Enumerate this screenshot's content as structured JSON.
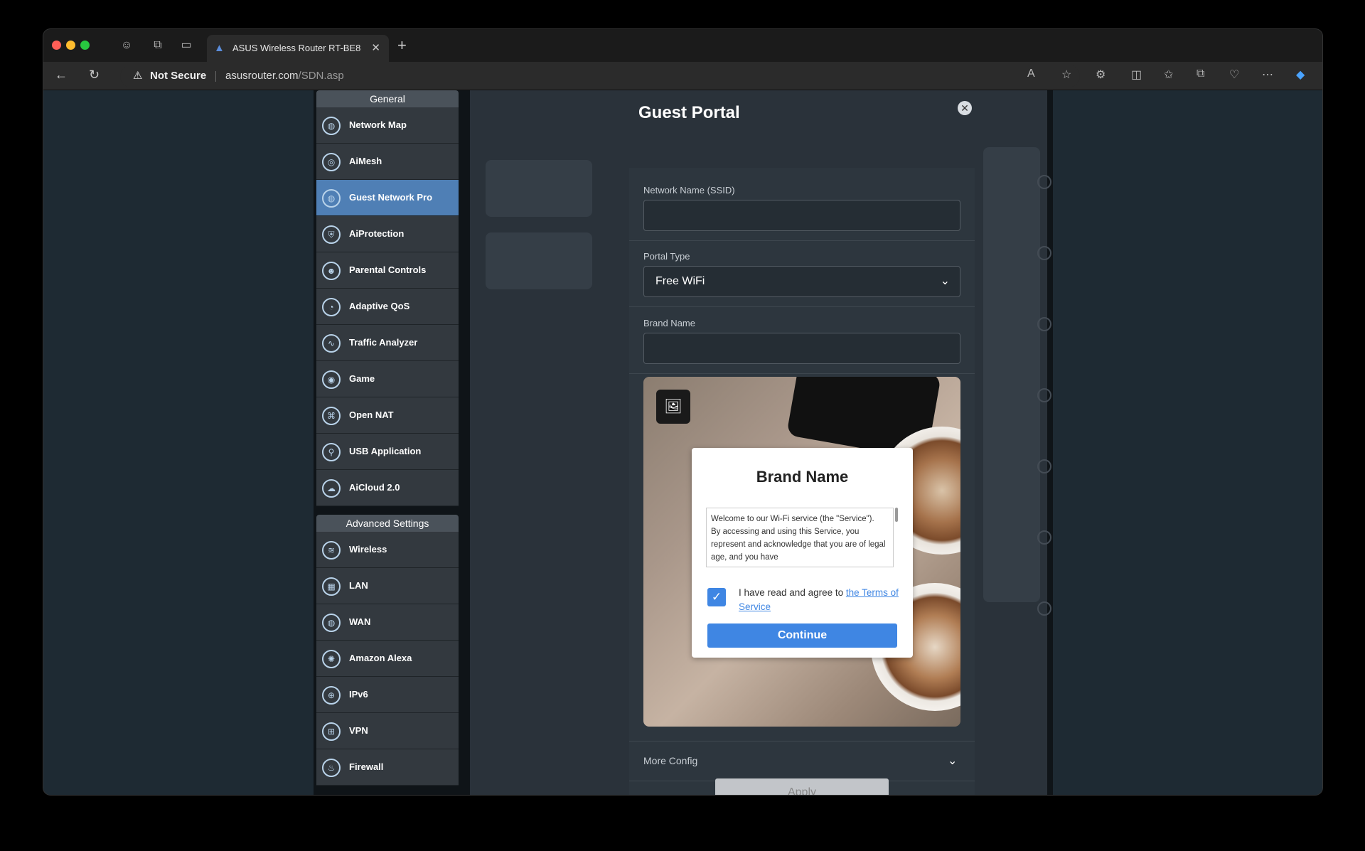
{
  "browser": {
    "tab_title": "ASUS Wireless Router RT-BE8",
    "security_label": "Not Secure",
    "url_host": "asusrouter.com",
    "url_path": "/SDN.asp"
  },
  "sidebar": {
    "general_title": "General",
    "general_items": [
      {
        "label": "Network Map",
        "icon": "globe-icon"
      },
      {
        "label": "AiMesh",
        "icon": "mesh-icon"
      },
      {
        "label": "Guest Network Pro",
        "icon": "globe-icon",
        "active": true
      },
      {
        "label": "AiProtection",
        "icon": "shield-icon"
      },
      {
        "label": "Parental Controls",
        "icon": "family-icon"
      },
      {
        "label": "Adaptive QoS",
        "icon": "gauge-icon"
      },
      {
        "label": "Traffic Analyzer",
        "icon": "chart-icon"
      },
      {
        "label": "Game",
        "icon": "gamepad-icon"
      },
      {
        "label": "Open NAT",
        "icon": "network-icon"
      },
      {
        "label": "USB Application",
        "icon": "usb-icon"
      },
      {
        "label": "AiCloud 2.0",
        "icon": "cloud-icon"
      }
    ],
    "advanced_title": "Advanced Settings",
    "advanced_items": [
      {
        "label": "Wireless",
        "icon": "wifi-icon"
      },
      {
        "label": "LAN",
        "icon": "lan-icon"
      },
      {
        "label": "WAN",
        "icon": "globe-icon"
      },
      {
        "label": "Amazon Alexa",
        "icon": "alexa-icon"
      },
      {
        "label": "IPv6",
        "icon": "ipv6-icon"
      },
      {
        "label": "VPN",
        "icon": "vpn-icon"
      },
      {
        "label": "Firewall",
        "icon": "fire-icon"
      }
    ]
  },
  "modal": {
    "title": "Guest Portal",
    "ssid_label": "Network Name (SSID)",
    "ssid_value": "",
    "portal_type_label": "Portal Type",
    "portal_type_value": "Free WiFi",
    "brand_name_label": "Brand Name",
    "brand_name_value": "",
    "preview": {
      "brand_title": "Brand Name",
      "terms_text": "Welcome to our Wi-Fi service (the \"Service\"). By accessing and using this Service, you represent and acknowledge that you are of legal age, and you have",
      "checkbox_checked": true,
      "agree_text": "I have read and agree to ",
      "agree_link": "the Terms of Service",
      "continue_label": "Continue"
    },
    "more_config_label": "More Config",
    "apply_label": "Apply"
  }
}
